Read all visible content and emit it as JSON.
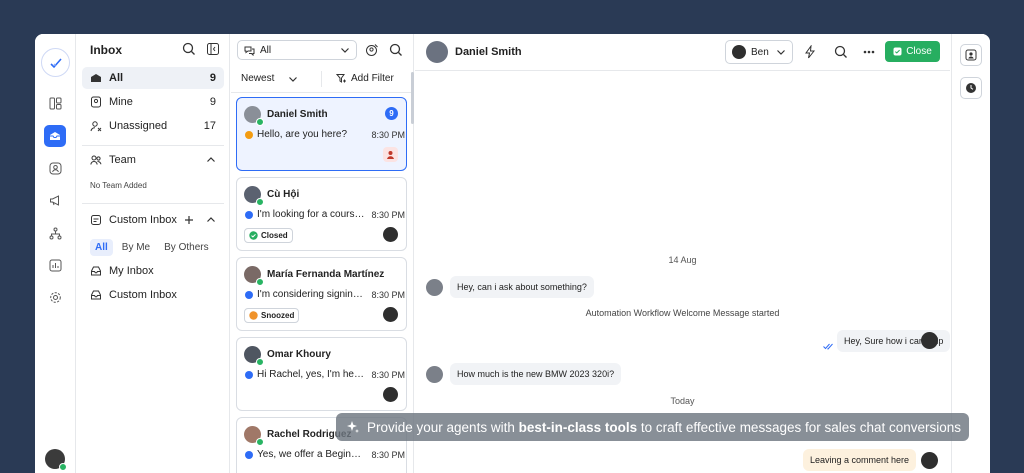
{
  "sidebar": {
    "title": "Inbox",
    "items": [
      {
        "label": "All",
        "count": "9"
      },
      {
        "label": "Mine",
        "count": "9"
      },
      {
        "label": "Unassigned",
        "count": "17"
      }
    ],
    "team_label": "Team",
    "team_empty": "No Team Added",
    "custom_label": "Custom Inbox",
    "filters": [
      "All",
      "By Me",
      "By Others"
    ],
    "custom_items": [
      "My Inbox",
      "Custom Inbox"
    ]
  },
  "list": {
    "filter_value": "All",
    "sort_label": "Newest",
    "add_filter": "Add Filter",
    "conversations": [
      {
        "name": "Daniel Smith",
        "message": "Hello, are you here?",
        "time": "8:30 PM",
        "badge": "9"
      },
      {
        "name": "Cù Hội",
        "message": "I'm looking for a course...",
        "time": "8:30 PM",
        "tag": "Closed"
      },
      {
        "name": "María Fernanda Martínez",
        "message": "I'm considering signing...",
        "time": "8:30 PM",
        "tag": "Snoozed"
      },
      {
        "name": "Omar Khoury",
        "message": "Hi Rachel, yes, I'm here...",
        "time": "8:30 PM"
      },
      {
        "name": "Rachel Rodriguez",
        "message": "Yes, we offer a Beginner...",
        "time": "8:30 PM"
      }
    ]
  },
  "chat": {
    "contact_name": "Daniel Smith",
    "assignee": "Ben",
    "close_label": "Close",
    "date1": "14 Aug",
    "msg1": "Hey, can i ask about something?",
    "system1": "Automation Workflow Welcome Message started",
    "msg2": "Hey, Sure how i can help",
    "msg3": "How much is the new BMW 2023 320i?",
    "date2": "Today",
    "comment": "Leaving a comment here"
  },
  "banner": {
    "pre": "Provide your agents with",
    "bold": "best-in-class tools",
    "post": "to craft effective messages for sales chat conversions"
  },
  "colors": {
    "accent": "#2e6cf6",
    "success": "#27ae60",
    "background": "#2a3a55"
  }
}
